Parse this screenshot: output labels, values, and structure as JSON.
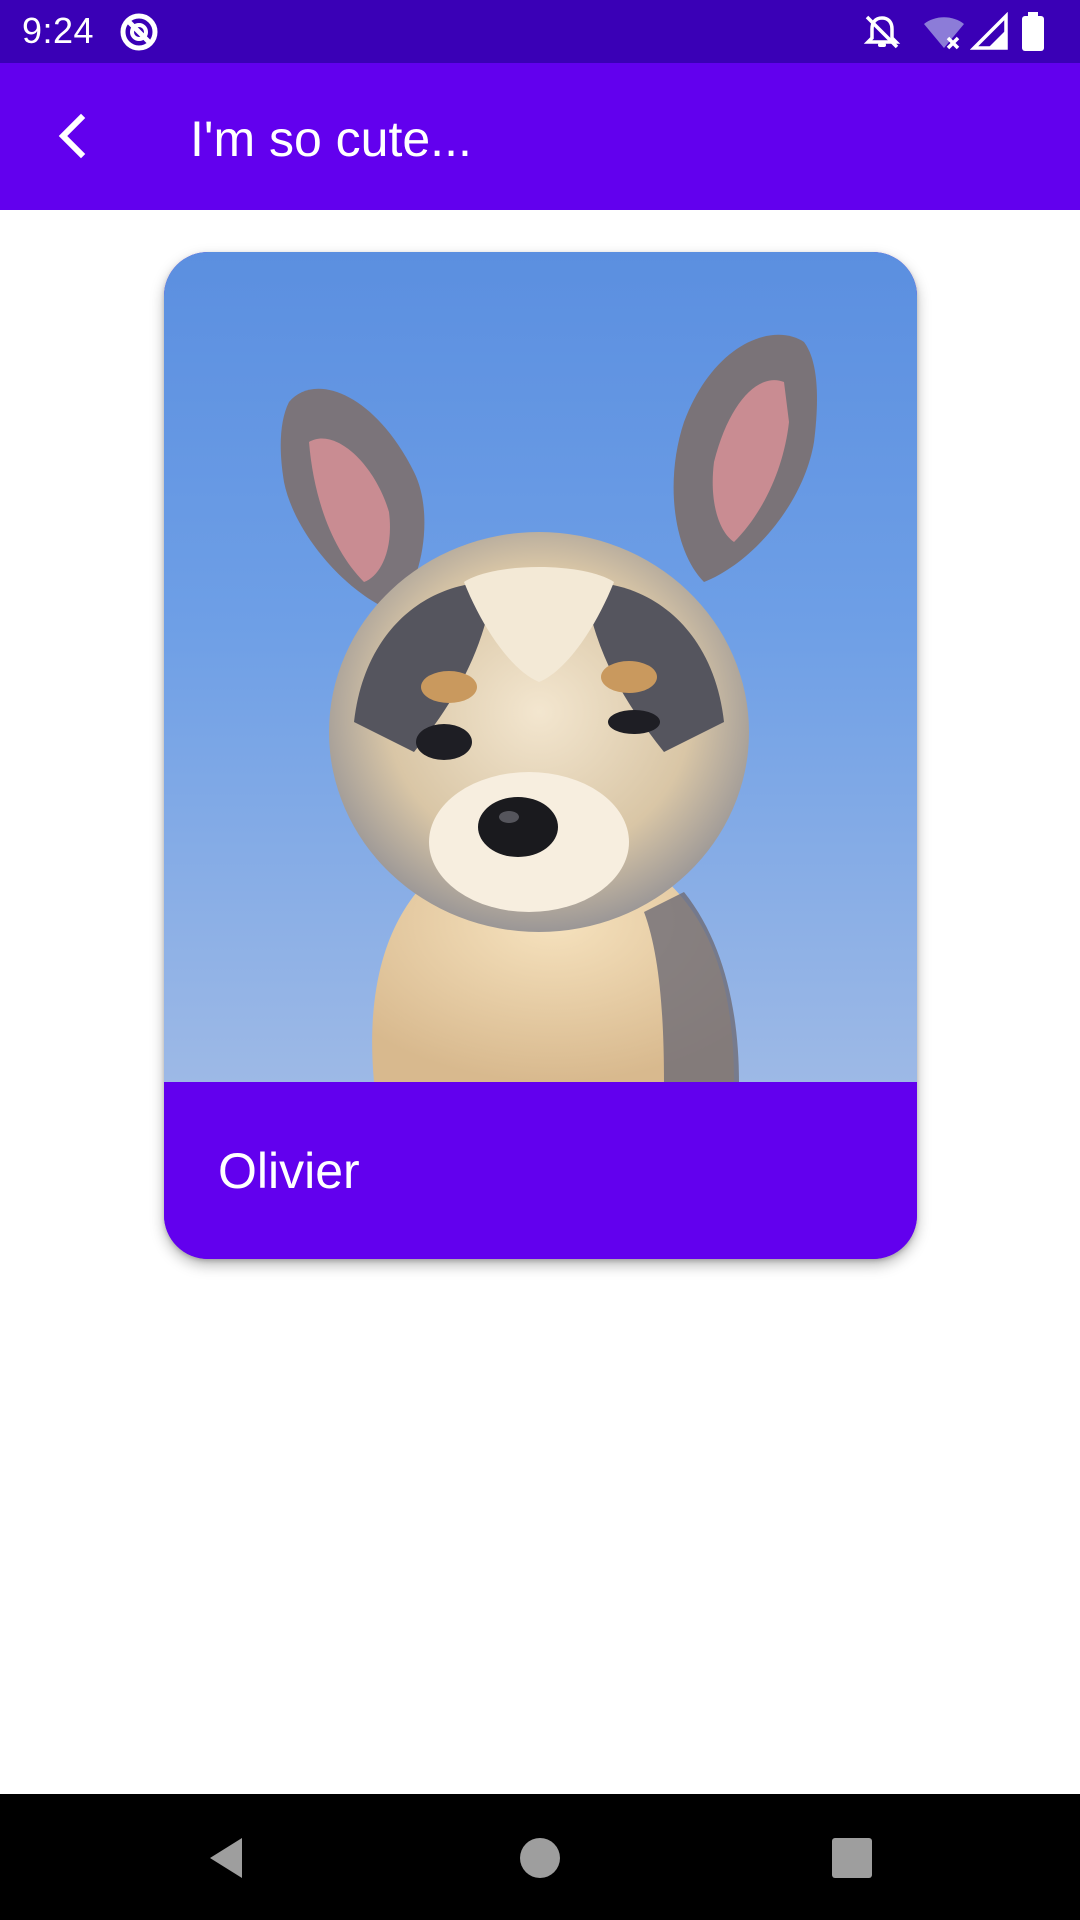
{
  "status_bar": {
    "time": "9:24",
    "icons": [
      "do-not-disturb-icon",
      "notifications-off-icon",
      "wifi-off-icon",
      "cell-signal-icon",
      "battery-icon"
    ]
  },
  "app_bar": {
    "title": "I'm so cute...",
    "back_icon": "chevron-left-icon"
  },
  "card": {
    "image_description_icon": "puppy-photo",
    "name": "Olivier"
  },
  "nav_bar": {
    "icons": [
      "back-triangle-icon",
      "home-circle-icon",
      "recents-square-icon"
    ]
  },
  "colors": {
    "status_bar": "#3A00B6",
    "primary": "#6200EE",
    "background": "#FFFFFF",
    "nav_bar": "#000000"
  }
}
